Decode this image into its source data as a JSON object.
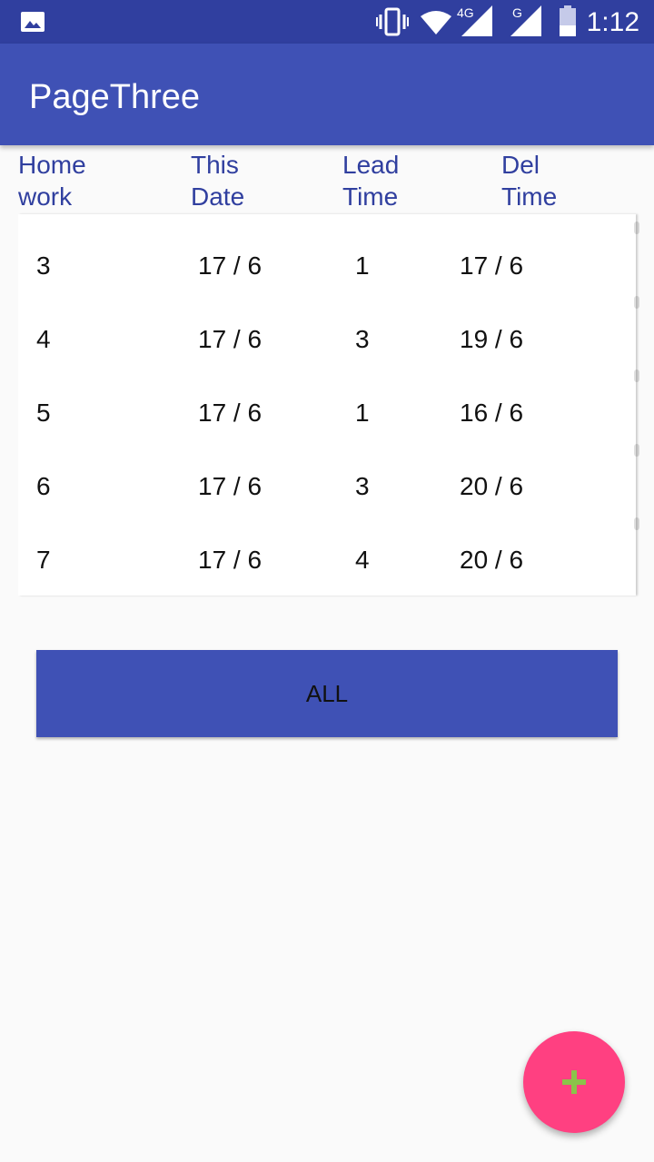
{
  "status_bar": {
    "time": "1:12",
    "network_4g_label": "4G",
    "network_g_label": "G",
    "icons": [
      "image-icon",
      "vibrate-icon",
      "wifi-icon",
      "signal-4g-icon",
      "signal-g-icon",
      "battery-icon"
    ]
  },
  "app_bar": {
    "title": "PageThree"
  },
  "table": {
    "headers": [
      {
        "line1": "Home",
        "line2": "work"
      },
      {
        "line1": "This",
        "line2": "Date"
      },
      {
        "line1": "Lead",
        "line2": "Time"
      },
      {
        "line1": "Del",
        "line2": "Time"
      }
    ],
    "rows": [
      [
        "3",
        "17 / 6",
        "1",
        "17 / 6"
      ],
      [
        "4",
        "17 / 6",
        "3",
        "19 / 6"
      ],
      [
        "5",
        "17 / 6",
        "1",
        "16 / 6"
      ],
      [
        "6",
        "17 / 6",
        "3",
        "20 / 6"
      ],
      [
        "7",
        "17 / 6",
        "4",
        "20 / 6"
      ]
    ]
  },
  "all_button": {
    "label": "ALL"
  },
  "fab": {
    "icon": "plus-icon"
  },
  "colors": {
    "status_bar": "#303f9f",
    "app_bar": "#3f51b5",
    "header_text": "#303f9f",
    "fab": "#ff4081",
    "fab_icon": "#8bc34a"
  }
}
